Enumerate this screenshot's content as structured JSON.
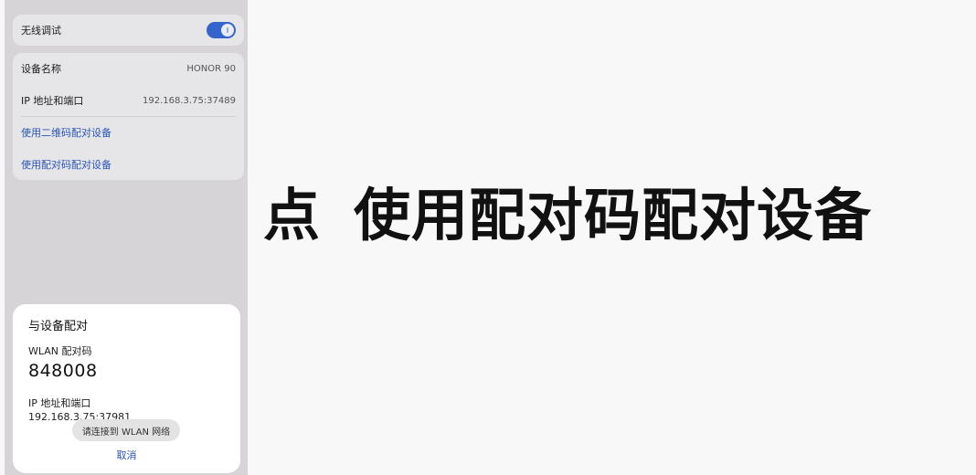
{
  "settings": {
    "wireless_debug_label": "无线调试",
    "wireless_debug_on": true,
    "device_name_label": "设备名称",
    "device_name_value": "HONOR 90",
    "ip_port_label": "IP 地址和端口",
    "ip_port_value": "192.168.3.75:37489",
    "pair_qr_link": "使用二维码配对设备",
    "pair_code_link": "使用配对码配对设备"
  },
  "dialog": {
    "title": "与设备配对",
    "wlan_code_label": "WLAN 配对码",
    "wlan_code_value": "848008",
    "ip_port_label": "IP 地址和端口",
    "ip_port_value": "192.168.3.75:37981",
    "toast": "请连接到 WLAN 网络",
    "cancel": "取消"
  },
  "caption": {
    "part1": "点",
    "part2": "使用配对码配对设备"
  },
  "colors": {
    "accent": "#3565cc",
    "link": "#2a55b4"
  }
}
